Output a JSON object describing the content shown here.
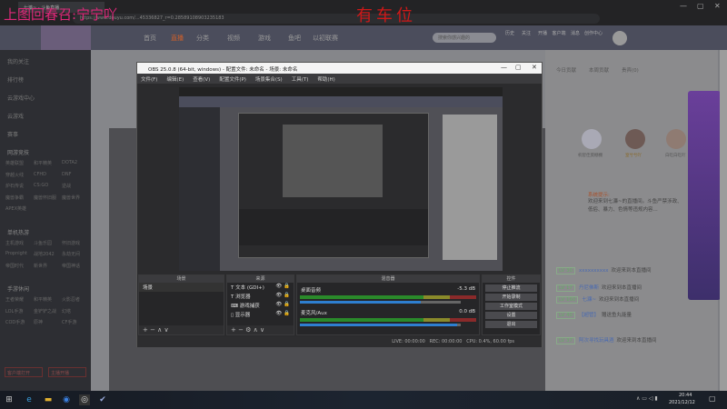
{
  "browser": {
    "tab_title": "七濂~ - 斗鱼直播 ...",
    "url": "https://www.douyu.com/...45336827_r=0.28589108903235183",
    "window_controls": [
      "—",
      "▢",
      "✕"
    ]
  },
  "overlay_text": {
    "left": "上图回春召:宁宁吖",
    "center": "有车位"
  },
  "site": {
    "nav": [
      "首页",
      "直播",
      "分类",
      "视频",
      "游戏",
      "鱼吧",
      "以初联赛"
    ],
    "search_placeholder": "搜索你感兴趣的",
    "header_icons": [
      "历史",
      "关注",
      "开播",
      "客户端",
      "消息",
      "创作中心"
    ]
  },
  "sidebar": {
    "items": [
      "我的关注",
      "排行榜",
      "云游戏中心",
      "云游戏",
      "赛事"
    ],
    "sections": [
      {
        "title": "网游竞技",
        "games": [
          "英雄联盟",
          "和平精英",
          "DOTA2",
          "穿越火线",
          "CFHD",
          "DNF",
          "炉石传说",
          "CS:GO",
          "逆战",
          "魔兽争霸",
          "魔兽怀旧服",
          "魔兽世界",
          "APEX英雄"
        ]
      },
      {
        "title": "单机热游",
        "games": [
          "主机游戏",
          "斗鱼乐园",
          "怀旧游戏",
          "Propnight",
          "战地2042",
          "永劫无间",
          "帝国时代",
          "新世界",
          "帝国神话"
        ]
      },
      {
        "title": "手游休闲",
        "games": [
          "王者荣耀",
          "和平精英",
          "火影忍者",
          "LOL手游",
          "金铲铲之战",
          "幻塔",
          "COD手游",
          "原神",
          "CF手游"
        ]
      }
    ],
    "buttons": [
      "客户端打开",
      "主播开播"
    ]
  },
  "obs": {
    "title": "OBS 25.0.8 (64-bit, windows) - 配置文件: 未命名 - 场景: 未命名",
    "menu": [
      "文件(F)",
      "编辑(E)",
      "查看(V)",
      "配置文件(P)",
      "场景集合(S)",
      "工具(T)",
      "帮助(H)"
    ],
    "docks": {
      "scenes": "场景",
      "sources": "来源",
      "mixer": "混音器",
      "controls": "控件"
    },
    "scene_items": [
      "场景"
    ],
    "sources": [
      {
        "icon": "text-icon",
        "name": "文本 (GDI+)"
      },
      {
        "icon": "text-icon",
        "name": "浏览器"
      },
      {
        "icon": "gamepad-icon",
        "name": "游戏捕获"
      },
      {
        "icon": "monitor-icon",
        "name": "显示器"
      }
    ],
    "mixer": [
      {
        "name": "桌面音频",
        "db": "-5.3 dB",
        "volume": 0.75
      },
      {
        "name": "麦克风/Aux",
        "db": "0.0 dB",
        "volume": 0.98
      }
    ],
    "controls": [
      "停止推流",
      "开始录制",
      "工作室模式",
      "设置",
      "退出"
    ],
    "status": {
      "live": "LIVE: 00:00:00",
      "rec": "REC: 00:00:00",
      "cpu": "CPU: 0.4%, 60.00 fps"
    }
  },
  "right_panel": {
    "tabs": [
      "今日贡献",
      "本周贡献",
      "贵宾(0)"
    ],
    "fans": [
      "机智佳莫棚棚",
      "窒兮兮吖",
      "白吃白吃吖"
    ],
    "notice_label": "系统提示:",
    "notice": "欢迎来到七濂~的直播间。斗鱼严禁涉政、低俗、暴力、色情等违规内容...",
    "chat": [
      {
        "level": "LV 30",
        "user": "xxxxxxxxxx",
        "msg": "欢迎来到本直播间"
      },
      {
        "level": "LV 17",
        "user": "丹尼佛斯",
        "msg": "欢迎来到本直播间"
      },
      {
        "level": "LV 160",
        "user": "七濂~",
        "msg": "欢迎来到本直播间"
      },
      {
        "level": "LV 40",
        "user": "【超管】",
        "msg": "赠送鱼丸能量"
      },
      {
        "level": "LV 37",
        "user": "阿次寻找玩具酒",
        "msg": "欢迎来到本直播间"
      }
    ]
  },
  "taskbar": {
    "time": "20:44",
    "date": "2021/12/12"
  }
}
